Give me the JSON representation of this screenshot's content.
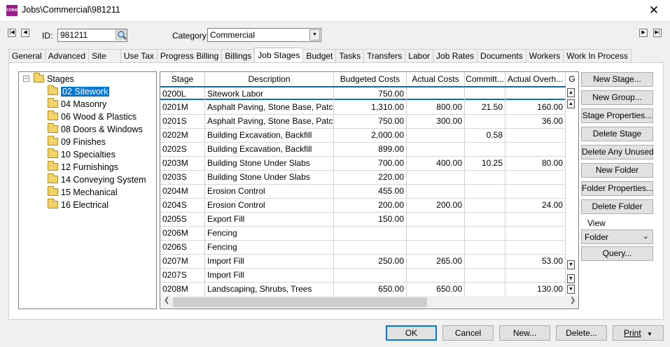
{
  "window": {
    "title": "Jobs\\Commercial\\981211",
    "logo_text": "COINS"
  },
  "header": {
    "id_label": "ID:",
    "id_value": "981211",
    "category_label": "Category:",
    "category_value": "Commercial"
  },
  "tabs": [
    "General",
    "Advanced",
    "Site",
    "Use Tax",
    "Progress Billing",
    "Billings",
    "Job Stages",
    "Budget",
    "Tasks",
    "Transfers",
    "Labor",
    "Job Rates",
    "Documents",
    "Workers",
    "Work In Process"
  ],
  "active_tab": "Job Stages",
  "tree": {
    "root": "Stages",
    "items": [
      "02 Sitework",
      "04 Masonry",
      "06 Wood & Plastics",
      "08 Doors & Windows",
      "09 Finishes",
      "10 Specialties",
      "12 Furnishings",
      "14 Conveying System",
      "15 Mechanical",
      "16 Electrical"
    ],
    "selected": "02 Sitework"
  },
  "grid": {
    "columns": [
      "Stage",
      "Description",
      "Budgeted Costs",
      "Actual Costs",
      "Committ...",
      "Actual Overh...",
      "G"
    ],
    "rows": [
      [
        "0200L",
        "Sitework Labor",
        "750.00",
        "",
        "",
        ""
      ],
      [
        "0201M",
        "Asphalt Paving, Stone Base, Patch",
        "1,310.00",
        "800.00",
        "21.50",
        "160.00"
      ],
      [
        "0201S",
        "Asphalt Paving, Stone Base, Patch",
        "750.00",
        "300.00",
        "",
        "36.00"
      ],
      [
        "0202M",
        "Building Excavation, Backfill",
        "2,000.00",
        "",
        "0.58",
        ""
      ],
      [
        "0202S",
        "Building Excavation, Backfill",
        "899.00",
        "",
        "",
        ""
      ],
      [
        "0203M",
        "Building Stone Under Slabs",
        "700.00",
        "400.00",
        "10.25",
        "80.00"
      ],
      [
        "0203S",
        "Building Stone Under Slabs",
        "220.00",
        "",
        "",
        ""
      ],
      [
        "0204M",
        "Erosion Control",
        "455.00",
        "",
        "",
        ""
      ],
      [
        "0204S",
        "Erosion Control",
        "200.00",
        "200.00",
        "",
        "24.00"
      ],
      [
        "0205S",
        "Export Fill",
        "150.00",
        "",
        "",
        ""
      ],
      [
        "0206M",
        "Fencing",
        "",
        "",
        "",
        ""
      ],
      [
        "0206S",
        "Fencing",
        "",
        "",
        "",
        ""
      ],
      [
        "0207M",
        "Import Fill",
        "250.00",
        "265.00",
        "",
        "53.00"
      ],
      [
        "0207S",
        "Import Fill",
        "",
        "",
        "",
        ""
      ],
      [
        "0208M",
        "Landscaping, Shrubs, Trees",
        "650.00",
        "650.00",
        "",
        "130.00"
      ]
    ]
  },
  "side_buttons": [
    "New Stage...",
    "New Group...",
    "Stage Properties...",
    "Delete Stage",
    "Delete Any Unused",
    "New Folder",
    "Folder Properties...",
    "Delete Folder"
  ],
  "view": {
    "label": "View",
    "value": "Folder"
  },
  "query_button": "Query...",
  "bottom_buttons": {
    "ok": "OK",
    "cancel": "Cancel",
    "new": "New...",
    "delete": "Delete...",
    "print": "Print"
  }
}
